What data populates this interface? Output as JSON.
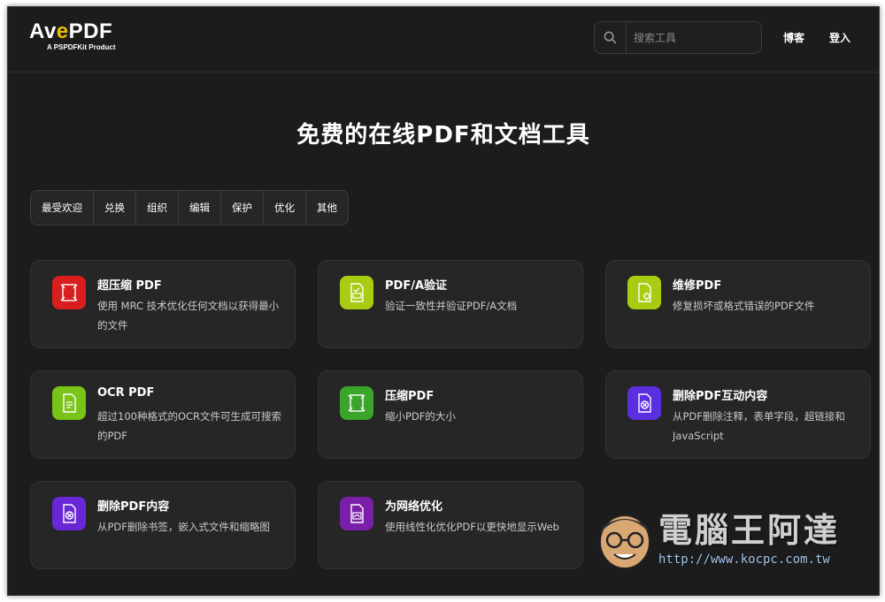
{
  "header": {
    "logo_main": "AvePDF",
    "logo_sub": "A PSPDFKit Product",
    "search_placeholder": "搜索工具",
    "nav": [
      "博客",
      "登入"
    ]
  },
  "page_title": "免费的在线PDF和文档工具",
  "tabs": [
    "最受欢迎",
    "兑换",
    "组织",
    "编辑",
    "保护",
    "优化",
    "其他"
  ],
  "cards": [
    {
      "title": "超压缩 PDF",
      "desc": "使用 MRC 技术优化任何文档以获得最小的文件",
      "color": "#d81e1e",
      "icon": "compress-icon"
    },
    {
      "title": "PDF/A验证",
      "desc": "验证一致性并验证PDF/A文档",
      "color": "#a8cc12",
      "icon": "pdfa-validate-icon"
    },
    {
      "title": "维修PDF",
      "desc": "修复损坏或格式错误的PDF文件",
      "color": "#a8cc12",
      "icon": "repair-icon"
    },
    {
      "title": "OCR PDF",
      "desc": "超过100种格式的OCR文件可生成可搜索的PDF",
      "color": "#7ac41a",
      "icon": "ocr-icon"
    },
    {
      "title": "压缩PDF",
      "desc": "缩小PDF的大小",
      "color": "#3aa52a",
      "icon": "compress-icon"
    },
    {
      "title": "删除PDF互动内容",
      "desc": "从PDF删除注释，表单字段，超链接和JavaScript",
      "color": "#5b2ee0",
      "icon": "remove-interactive-icon"
    },
    {
      "title": "删除PDF内容",
      "desc": "从PDF删除书签，嵌入式文件和缩略图",
      "color": "#6a27d8",
      "icon": "remove-content-icon"
    },
    {
      "title": "为网络优化",
      "desc": "使用线性化优化PDF以更快地显示Web",
      "color": "#7a1fa8",
      "icon": "web-optimize-icon"
    }
  ],
  "watermark": {
    "text": "電腦王阿達",
    "url": "http://www.kocpc.com.tw"
  }
}
